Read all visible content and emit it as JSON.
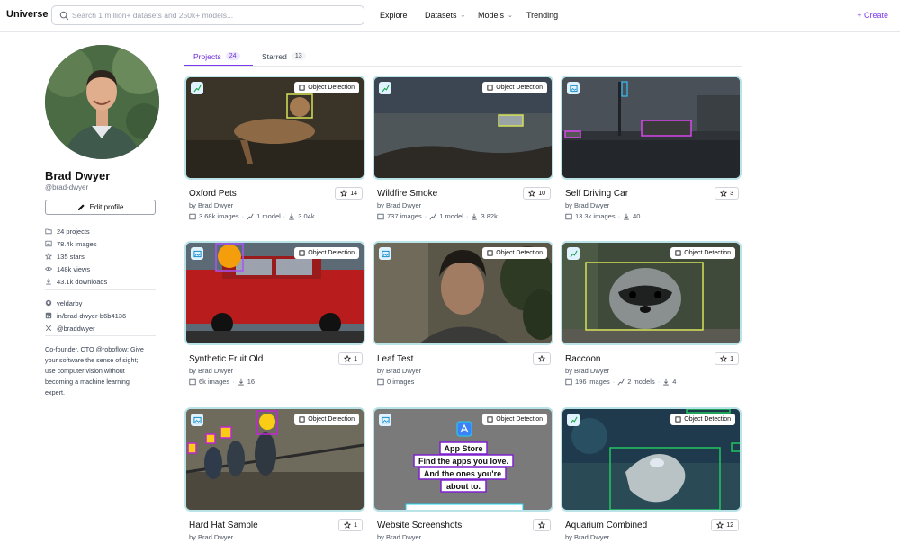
{
  "header": {
    "logo": "Universe",
    "search_placeholder": "Search 1 million+ datasets and 250k+ models...",
    "nav": [
      {
        "label": "Explore",
        "has_chevron": false
      },
      {
        "label": "Datasets",
        "has_chevron": true
      },
      {
        "label": "Models",
        "has_chevron": true
      },
      {
        "label": "Trending",
        "has_chevron": false
      }
    ],
    "create_label": "Create"
  },
  "profile": {
    "name": "Brad Dwyer",
    "handle": "@brad-dwyer",
    "edit_label": "Edit profile",
    "stats": [
      {
        "icon": "folder-icon",
        "text": "24 projects"
      },
      {
        "icon": "image-icon",
        "text": "78.4k images"
      },
      {
        "icon": "star-icon",
        "text": "135 stars"
      },
      {
        "icon": "eye-icon",
        "text": "148k views"
      },
      {
        "icon": "download-icon",
        "text": "43.1k downloads"
      }
    ],
    "socials": [
      {
        "icon": "github-icon",
        "text": "yeldarby"
      },
      {
        "icon": "linkedin-icon",
        "text": "in/brad-dwyer-b6b4136"
      },
      {
        "icon": "x-icon",
        "text": "@braddwyer"
      }
    ],
    "bio": "Co-founder, CTO @roboflow: Give your software the sense of sight; use computer vision without becoming a machine learning expert."
  },
  "tabs": [
    {
      "label": "Projects",
      "count": "24",
      "active": true
    },
    {
      "label": "Starred",
      "count": "13",
      "active": false
    }
  ],
  "projects": [
    {
      "title": "Oxford Pets",
      "by": "by Brad Dwyer",
      "stars": "14",
      "type_icon": "model-icon",
      "task": "Object Detection",
      "images": "3.68k images",
      "models": "1 model",
      "downloads": "3.04k"
    },
    {
      "title": "Wildfire Smoke",
      "by": "by Brad Dwyer",
      "stars": "10",
      "type_icon": "model-icon",
      "task": "Object Detection",
      "images": "737 images",
      "models": "1 model",
      "downloads": "3.82k"
    },
    {
      "title": "Self Driving Car",
      "by": "by Brad Dwyer",
      "stars": "3",
      "type_icon": "image-icon",
      "task": "",
      "images": "13.3k images",
      "models": "",
      "downloads": "40"
    },
    {
      "title": "Synthetic Fruit Old",
      "by": "by Brad Dwyer",
      "stars": "1",
      "type_icon": "image-icon",
      "task": "Object Detection",
      "images": "6k images",
      "models": "",
      "downloads": "16"
    },
    {
      "title": "Leaf Test",
      "by": "by Brad Dwyer",
      "stars": "",
      "type_icon": "image-icon",
      "task": "Object Detection",
      "images": "0 images",
      "models": "",
      "downloads": ""
    },
    {
      "title": "Raccoon",
      "by": "by Brad Dwyer",
      "stars": "1",
      "type_icon": "model-icon",
      "task": "Object Detection",
      "images": "196 images",
      "models": "2 models",
      "downloads": "4"
    },
    {
      "title": "Hard Hat Sample",
      "by": "by Brad Dwyer",
      "stars": "1",
      "type_icon": "image-icon",
      "task": "Object Detection",
      "images": "",
      "models": "",
      "downloads": ""
    },
    {
      "title": "Website Screenshots",
      "by": "by Brad Dwyer",
      "stars": "",
      "type_icon": "image-icon",
      "task": "Object Detection",
      "images": "",
      "models": "",
      "downloads": "",
      "thumb_text": [
        "App Store",
        "Find the apps you love.",
        "And the ones you're",
        "about to."
      ]
    },
    {
      "title": "Aquarium Combined",
      "by": "by Brad Dwyer",
      "stars": "12",
      "type_icon": "model-icon",
      "task": "Object Detection",
      "images": "",
      "models": "",
      "downloads": ""
    }
  ],
  "colors": {
    "accent": "#7c3aed",
    "card_border": "#b9e3e7"
  }
}
